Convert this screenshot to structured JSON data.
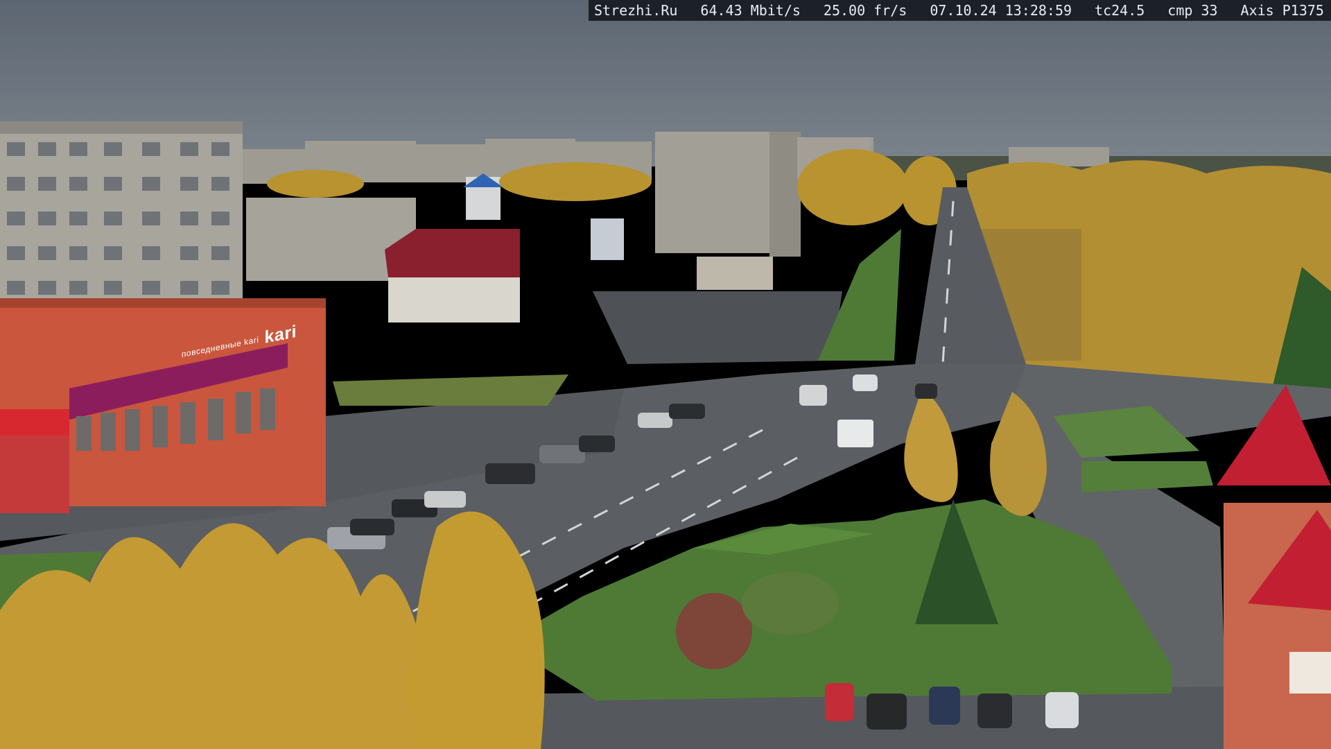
{
  "camera_overlay": {
    "site": "Strezhi.Ru",
    "bitrate": "64.43 Mbit/s",
    "framerate": "25.00 fr/s",
    "datetime": "07.10.24 13:28:59",
    "tc": "tc24.5",
    "cmp": "cmp 33",
    "camera_model": "Axis P1375"
  },
  "scene": {
    "store_sign": "kari",
    "store_sign_small": "повседневные kari",
    "palette": {
      "sky": "#67717c",
      "asphalt": "#5b5f63",
      "grass": "#4f7a36",
      "autumn_foliage": "#c9a032",
      "store_facade": "#c9563d",
      "store_banner": "#8c1d5d",
      "red_roof": "#c21f33",
      "panel_building": "#a5a39b"
    }
  }
}
